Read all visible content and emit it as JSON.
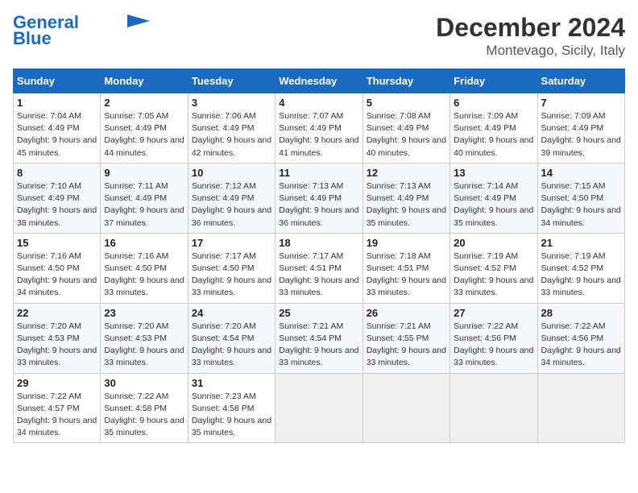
{
  "header": {
    "logo_line1": "General",
    "logo_line2": "Blue",
    "title": "December 2024",
    "subtitle": "Montevago, Sicily, Italy"
  },
  "weekdays": [
    "Sunday",
    "Monday",
    "Tuesday",
    "Wednesday",
    "Thursday",
    "Friday",
    "Saturday"
  ],
  "weeks": [
    [
      {
        "day": "1",
        "sunrise": "Sunrise: 7:04 AM",
        "sunset": "Sunset: 4:49 PM",
        "daylight": "Daylight: 9 hours and 45 minutes."
      },
      {
        "day": "2",
        "sunrise": "Sunrise: 7:05 AM",
        "sunset": "Sunset: 4:49 PM",
        "daylight": "Daylight: 9 hours and 44 minutes."
      },
      {
        "day": "3",
        "sunrise": "Sunrise: 7:06 AM",
        "sunset": "Sunset: 4:49 PM",
        "daylight": "Daylight: 9 hours and 42 minutes."
      },
      {
        "day": "4",
        "sunrise": "Sunrise: 7:07 AM",
        "sunset": "Sunset: 4:49 PM",
        "daylight": "Daylight: 9 hours and 41 minutes."
      },
      {
        "day": "5",
        "sunrise": "Sunrise: 7:08 AM",
        "sunset": "Sunset: 4:49 PM",
        "daylight": "Daylight: 9 hours and 40 minutes."
      },
      {
        "day": "6",
        "sunrise": "Sunrise: 7:09 AM",
        "sunset": "Sunset: 4:49 PM",
        "daylight": "Daylight: 9 hours and 40 minutes."
      },
      {
        "day": "7",
        "sunrise": "Sunrise: 7:09 AM",
        "sunset": "Sunset: 4:49 PM",
        "daylight": "Daylight: 9 hours and 39 minutes."
      }
    ],
    [
      {
        "day": "8",
        "sunrise": "Sunrise: 7:10 AM",
        "sunset": "Sunset: 4:49 PM",
        "daylight": "Daylight: 9 hours and 38 minutes."
      },
      {
        "day": "9",
        "sunrise": "Sunrise: 7:11 AM",
        "sunset": "Sunset: 4:49 PM",
        "daylight": "Daylight: 9 hours and 37 minutes."
      },
      {
        "day": "10",
        "sunrise": "Sunrise: 7:12 AM",
        "sunset": "Sunset: 4:49 PM",
        "daylight": "Daylight: 9 hours and 36 minutes."
      },
      {
        "day": "11",
        "sunrise": "Sunrise: 7:13 AM",
        "sunset": "Sunset: 4:49 PM",
        "daylight": "Daylight: 9 hours and 36 minutes."
      },
      {
        "day": "12",
        "sunrise": "Sunrise: 7:13 AM",
        "sunset": "Sunset: 4:49 PM",
        "daylight": "Daylight: 9 hours and 35 minutes."
      },
      {
        "day": "13",
        "sunrise": "Sunrise: 7:14 AM",
        "sunset": "Sunset: 4:49 PM",
        "daylight": "Daylight: 9 hours and 35 minutes."
      },
      {
        "day": "14",
        "sunrise": "Sunrise: 7:15 AM",
        "sunset": "Sunset: 4:50 PM",
        "daylight": "Daylight: 9 hours and 34 minutes."
      }
    ],
    [
      {
        "day": "15",
        "sunrise": "Sunrise: 7:16 AM",
        "sunset": "Sunset: 4:50 PM",
        "daylight": "Daylight: 9 hours and 34 minutes."
      },
      {
        "day": "16",
        "sunrise": "Sunrise: 7:16 AM",
        "sunset": "Sunset: 4:50 PM",
        "daylight": "Daylight: 9 hours and 33 minutes."
      },
      {
        "day": "17",
        "sunrise": "Sunrise: 7:17 AM",
        "sunset": "Sunset: 4:50 PM",
        "daylight": "Daylight: 9 hours and 33 minutes."
      },
      {
        "day": "18",
        "sunrise": "Sunrise: 7:17 AM",
        "sunset": "Sunset: 4:51 PM",
        "daylight": "Daylight: 9 hours and 33 minutes."
      },
      {
        "day": "19",
        "sunrise": "Sunrise: 7:18 AM",
        "sunset": "Sunset: 4:51 PM",
        "daylight": "Daylight: 9 hours and 33 minutes."
      },
      {
        "day": "20",
        "sunrise": "Sunrise: 7:19 AM",
        "sunset": "Sunset: 4:52 PM",
        "daylight": "Daylight: 9 hours and 33 minutes."
      },
      {
        "day": "21",
        "sunrise": "Sunrise: 7:19 AM",
        "sunset": "Sunset: 4:52 PM",
        "daylight": "Daylight: 9 hours and 33 minutes."
      }
    ],
    [
      {
        "day": "22",
        "sunrise": "Sunrise: 7:20 AM",
        "sunset": "Sunset: 4:53 PM",
        "daylight": "Daylight: 9 hours and 33 minutes."
      },
      {
        "day": "23",
        "sunrise": "Sunrise: 7:20 AM",
        "sunset": "Sunset: 4:53 PM",
        "daylight": "Daylight: 9 hours and 33 minutes."
      },
      {
        "day": "24",
        "sunrise": "Sunrise: 7:20 AM",
        "sunset": "Sunset: 4:54 PM",
        "daylight": "Daylight: 9 hours and 33 minutes."
      },
      {
        "day": "25",
        "sunrise": "Sunrise: 7:21 AM",
        "sunset": "Sunset: 4:54 PM",
        "daylight": "Daylight: 9 hours and 33 minutes."
      },
      {
        "day": "26",
        "sunrise": "Sunrise: 7:21 AM",
        "sunset": "Sunset: 4:55 PM",
        "daylight": "Daylight: 9 hours and 33 minutes."
      },
      {
        "day": "27",
        "sunrise": "Sunrise: 7:22 AM",
        "sunset": "Sunset: 4:56 PM",
        "daylight": "Daylight: 9 hours and 33 minutes."
      },
      {
        "day": "28",
        "sunrise": "Sunrise: 7:22 AM",
        "sunset": "Sunset: 4:56 PM",
        "daylight": "Daylight: 9 hours and 34 minutes."
      }
    ],
    [
      {
        "day": "29",
        "sunrise": "Sunrise: 7:22 AM",
        "sunset": "Sunset: 4:57 PM",
        "daylight": "Daylight: 9 hours and 34 minutes."
      },
      {
        "day": "30",
        "sunrise": "Sunrise: 7:22 AM",
        "sunset": "Sunset: 4:58 PM",
        "daylight": "Daylight: 9 hours and 35 minutes."
      },
      {
        "day": "31",
        "sunrise": "Sunrise: 7:23 AM",
        "sunset": "Sunset: 4:58 PM",
        "daylight": "Daylight: 9 hours and 35 minutes."
      },
      null,
      null,
      null,
      null
    ]
  ]
}
